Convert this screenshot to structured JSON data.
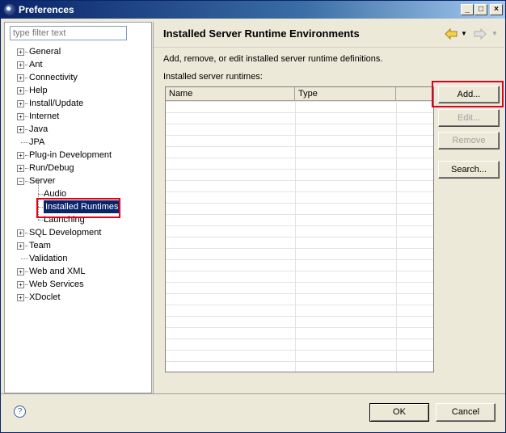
{
  "window": {
    "title": "Preferences"
  },
  "filter": {
    "placeholder": "type filter text"
  },
  "tree": {
    "items": [
      {
        "label": "General",
        "expandable": true
      },
      {
        "label": "Ant",
        "expandable": true
      },
      {
        "label": "Connectivity",
        "expandable": true
      },
      {
        "label": "Help",
        "expandable": true
      },
      {
        "label": "Install/Update",
        "expandable": true
      },
      {
        "label": "Internet",
        "expandable": true
      },
      {
        "label": "Java",
        "expandable": true
      },
      {
        "label": "JPA",
        "expandable": false
      },
      {
        "label": "Plug-in Development",
        "expandable": true
      },
      {
        "label": "Run/Debug",
        "expandable": true
      },
      {
        "label": "Server",
        "expandable": true,
        "expanded": true
      },
      {
        "label": "Audio",
        "child": true
      },
      {
        "label": "Installed Runtimes",
        "child": true,
        "selected": true
      },
      {
        "label": "Launching",
        "child": true
      },
      {
        "label": "SQL Development",
        "expandable": true
      },
      {
        "label": "Team",
        "expandable": true
      },
      {
        "label": "Validation",
        "expandable": false
      },
      {
        "label": "Web and XML",
        "expandable": true
      },
      {
        "label": "Web Services",
        "expandable": true
      },
      {
        "label": "XDoclet",
        "expandable": true
      }
    ]
  },
  "page": {
    "title": "Installed Server Runtime Environments",
    "description": "Add, remove, or edit installed server runtime definitions.",
    "list_label": "Installed server runtimes:",
    "columns": [
      "Name",
      "Type",
      ""
    ]
  },
  "buttons": {
    "add": "Add...",
    "edit": "Edit...",
    "remove": "Remove",
    "search": "Search...",
    "ok": "OK",
    "cancel": "Cancel"
  },
  "icons": {
    "back": "back-arrow-icon",
    "forward": "forward-arrow-icon",
    "help": "help-icon"
  },
  "colors": {
    "highlight": "#e2001a",
    "selection": "#0a246a",
    "titlebar": "#0a246a"
  }
}
